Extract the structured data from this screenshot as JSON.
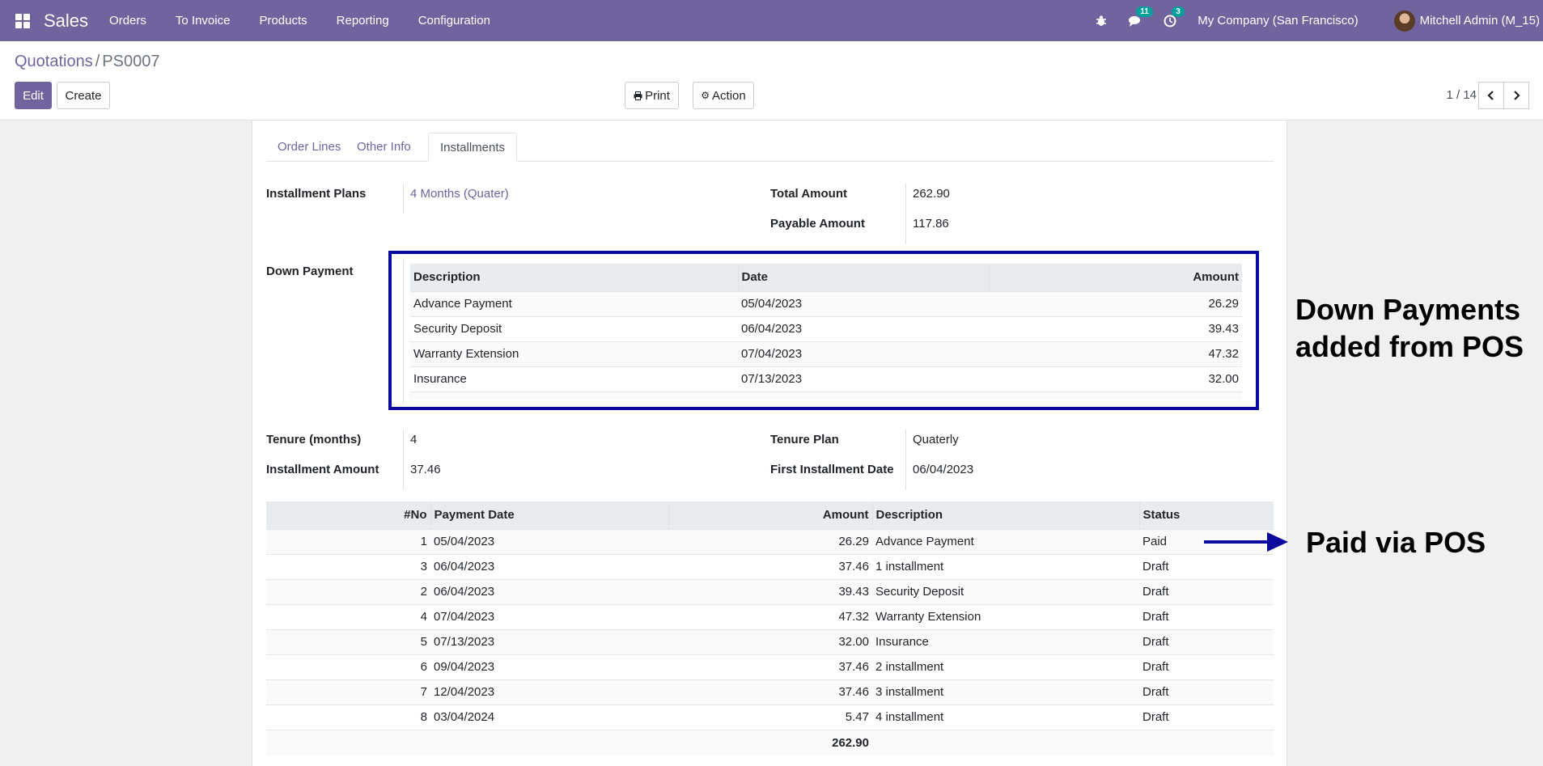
{
  "navbar": {
    "brand": "Sales",
    "menu": [
      "Orders",
      "To Invoice",
      "Products",
      "Reporting",
      "Configuration"
    ],
    "messages_count": "11",
    "activities_count": "3",
    "company": "My Company (San Francisco)",
    "user": "Mitchell Admin (M_15)"
  },
  "breadcrumb": {
    "parent": "Quotations",
    "separator": "/",
    "current": "PS0007"
  },
  "buttons": {
    "edit": "Edit",
    "create": "Create",
    "print": "Print",
    "action": "Action"
  },
  "pager": {
    "text": "1 / 14"
  },
  "tabs": [
    "Order Lines",
    "Other Info",
    "Installments"
  ],
  "fields": {
    "installment_plans_label": "Installment Plans",
    "installment_plans_value": "4 Months (Quater)",
    "total_amount_label": "Total Amount",
    "total_amount_value": "262.90",
    "payable_amount_label": "Payable Amount",
    "payable_amount_value": "117.86",
    "down_payment_label": "Down Payment",
    "tenure_months_label": "Tenure (months)",
    "tenure_months_value": "4",
    "tenure_plan_label": "Tenure Plan",
    "tenure_plan_value": "Quaterly",
    "installment_amount_label": "Installment Amount",
    "installment_amount_value": "37.46",
    "first_installment_date_label": "First Installment Date",
    "first_installment_date_value": "06/04/2023"
  },
  "down_payments": {
    "headers": [
      "Description",
      "Date",
      "Amount"
    ],
    "rows": [
      [
        "Advance Payment",
        "05/04/2023",
        "26.29"
      ],
      [
        "Security Deposit",
        "06/04/2023",
        "39.43"
      ],
      [
        "Warranty Extension",
        "07/04/2023",
        "47.32"
      ],
      [
        "Insurance",
        "07/13/2023",
        "32.00"
      ]
    ]
  },
  "installments": {
    "headers": [
      "#No",
      "Payment Date",
      "Amount",
      "Description",
      "Status"
    ],
    "rows": [
      [
        "1",
        "05/04/2023",
        "26.29",
        "Advance Payment",
        "Paid"
      ],
      [
        "3",
        "06/04/2023",
        "37.46",
        "1 installment",
        "Draft"
      ],
      [
        "2",
        "06/04/2023",
        "39.43",
        "Security Deposit",
        "Draft"
      ],
      [
        "4",
        "07/04/2023",
        "47.32",
        "Warranty Extension",
        "Draft"
      ],
      [
        "5",
        "07/13/2023",
        "32.00",
        "Insurance",
        "Draft"
      ],
      [
        "6",
        "09/04/2023",
        "37.46",
        "2 installment",
        "Draft"
      ],
      [
        "7",
        "12/04/2023",
        "37.46",
        "3 installment",
        "Draft"
      ],
      [
        "8",
        "03/04/2024",
        "5.47",
        "4 installment",
        "Draft"
      ]
    ],
    "total": "262.90"
  },
  "annotations": {
    "down_payments_line1": "Down Payments",
    "down_payments_line2": "added from POS",
    "paid_via_pos": "Paid via POS"
  },
  "colors": {
    "brand": "#71639e",
    "highlight": "#0a0a9c",
    "badge": "#00a09d"
  }
}
